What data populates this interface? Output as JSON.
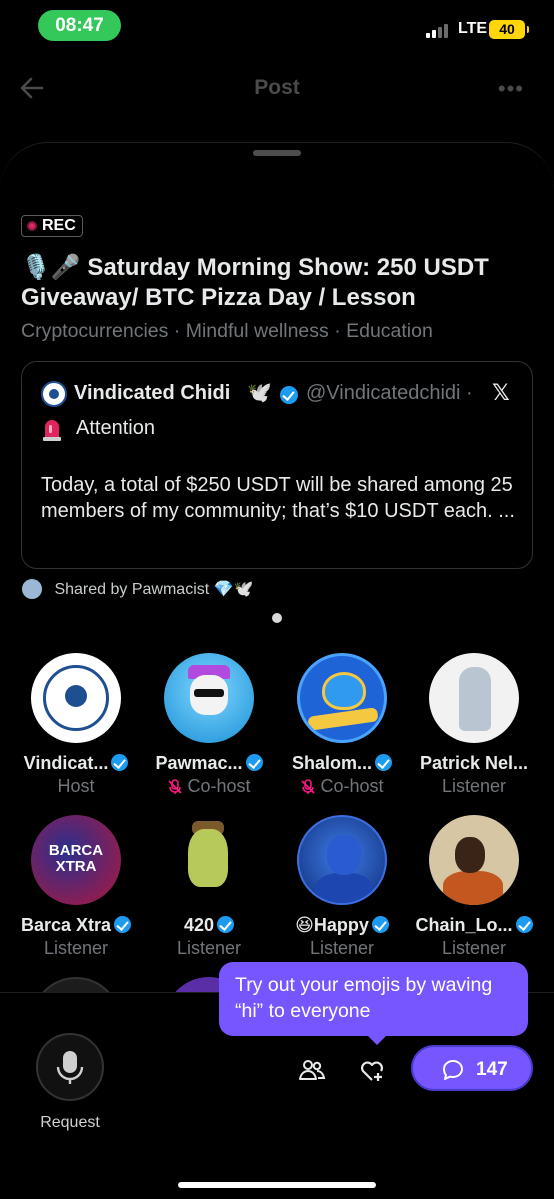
{
  "status_bar": {
    "time": "08:47",
    "network": "LTE",
    "battery": "40"
  },
  "header": {
    "title": "Post",
    "more": "•••"
  },
  "space": {
    "rec_label": "REC",
    "title": "🎙️🎤 Saturday Morning Show: 250 USDT Giveaway/ BTC Pizza Day / Lesson",
    "topics": "Cryptocurrencies · Mindful wellness · Education"
  },
  "pinned_post": {
    "author_name": "Vindicated Chidi",
    "author_emoji": "🕊️",
    "handle": "@Vindicatedchidi ·",
    "x_logo": "𝕏",
    "siren_label": "Attention",
    "body": "Today, a total of $250 USDT will be shared among 25 members of my community; that’s $10 USDT each. ..."
  },
  "shared_by": {
    "text": "Shared by Pawmacist 💎🕊️"
  },
  "participants": [
    {
      "name": "Vindicat...",
      "role": "Host",
      "verified": true,
      "muted": false,
      "avatar": "vc"
    },
    {
      "name": "Pawmac...",
      "role": "Co-host",
      "verified": true,
      "muted": true,
      "avatar": "paw"
    },
    {
      "name": "Shalom...",
      "role": "Co-host",
      "verified": true,
      "muted": true,
      "avatar": "shalom"
    },
    {
      "name": "Patrick Nel...",
      "role": "Listener",
      "verified": false,
      "muted": false,
      "avatar": "patrick"
    },
    {
      "name": "Barca Xtra",
      "role": "Listener",
      "verified": true,
      "muted": false,
      "avatar": "barca",
      "avatar_text": "BARCA XTRA"
    },
    {
      "name": "420",
      "role": "Listener",
      "verified": true,
      "muted": false,
      "avatar": "420"
    },
    {
      "name": "😆Happy",
      "role": "Listener",
      "verified": true,
      "muted": false,
      "avatar": "happy"
    },
    {
      "name": "Chain_Lo...",
      "role": "Listener",
      "verified": true,
      "muted": false,
      "avatar": "chain"
    }
  ],
  "tooltip": {
    "text": "Try out your emojis by waving “hi” to everyone"
  },
  "bottom_bar": {
    "request_label": "Request",
    "comments_count": "147"
  },
  "colors": {
    "accent": "#7856ff",
    "verified": "#1d9bf0",
    "muted_text": "#71767b",
    "rec": "#e0245e"
  }
}
